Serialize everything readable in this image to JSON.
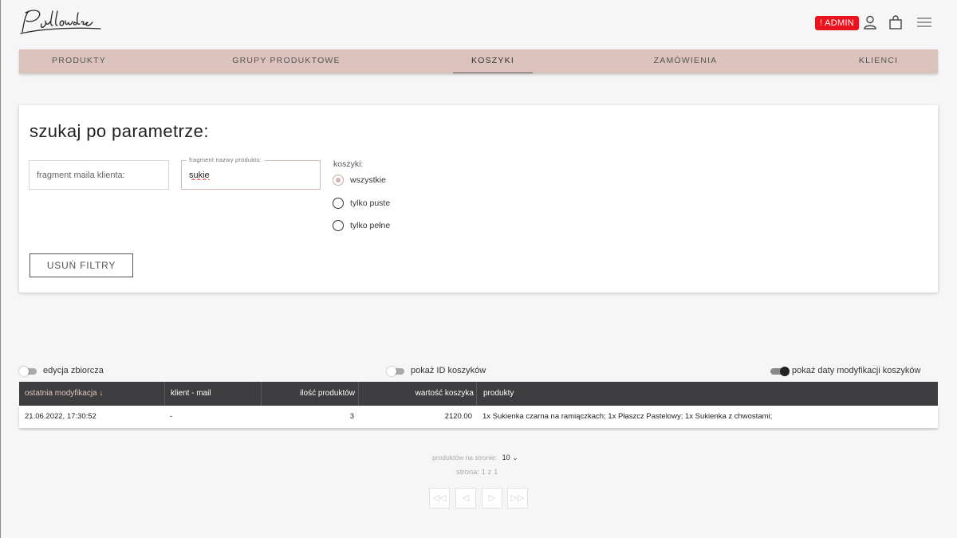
{
  "brand": {
    "logo_text": "Pudłowska"
  },
  "header": {
    "admin_badge": "! ADMIN",
    "icons": [
      "user-icon",
      "shopping-bag-icon",
      "hamburger-menu-icon"
    ]
  },
  "nav": {
    "items": [
      {
        "label": "PRODUKTY",
        "active": false
      },
      {
        "label": "GRUPY PRODUKTOWE",
        "active": false
      },
      {
        "label": "KOSZYKI",
        "active": true
      },
      {
        "label": "ZAMÓWIENIA",
        "active": false
      },
      {
        "label": "KLIENCI",
        "active": false
      }
    ],
    "bg_color": "#dcc2bd"
  },
  "filters": {
    "title": "szukaj po parametrze:",
    "email_placeholder": "fragment maila klienta:",
    "product_legend": "fragment nazwy produktu:",
    "product_value": "sukie",
    "radio_label": "koszyki:",
    "radios": [
      {
        "label": "wszystkie",
        "checked": true
      },
      {
        "label": "tylko puste",
        "checked": false
      },
      {
        "label": "tylko pełne",
        "checked": false
      }
    ],
    "clear_button": "USUŃ FILTRY"
  },
  "toggles": [
    {
      "label": "edycja zbiorcza",
      "on": false
    },
    {
      "label": "pokaż ID koszyków",
      "on": false
    },
    {
      "label": "pokaż daty modyfikacji koszyków",
      "on": true
    }
  ],
  "table": {
    "columns": [
      "ostatnia modyfikacja ↓",
      "klient - mail",
      "ilość produktów",
      "wartość koszyka",
      "produkty"
    ],
    "rows": [
      [
        "21.06.2022, 17:30:52",
        "-",
        "3",
        "2120.00",
        "1x Sukienka czarna na ramiączkach; 1x Płaszcz Pastelowy; 1x Sukienka z chwostami;"
      ]
    ]
  },
  "pagination": {
    "per_page_label": "produktów na stronie:",
    "per_page_value": "10",
    "page_label": "strona: 1 z 1",
    "buttons": [
      "◁◁",
      "◁",
      "▷",
      "▷▷"
    ]
  },
  "colors": {
    "admin": "#e8141e",
    "table_header": "#3d3d3f",
    "accent": "#dcc2bd"
  }
}
